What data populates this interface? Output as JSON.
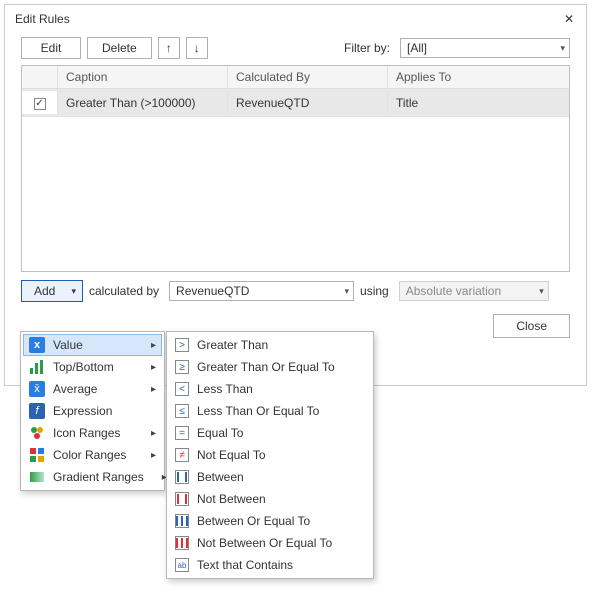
{
  "dialog": {
    "title": "Edit Rules",
    "close_icon": "✕"
  },
  "toolbar": {
    "edit": "Edit",
    "delete": "Delete",
    "up": "↑",
    "down": "↓",
    "filter_label": "Filter by:",
    "filter_value": "[All]"
  },
  "grid": {
    "headers": {
      "caption": "Caption",
      "calc": "Calculated By",
      "applies": "Applies To"
    },
    "row": {
      "checked": "✓",
      "caption": "Greater Than (>100000)",
      "calc": "RevenueQTD",
      "applies": "Title"
    }
  },
  "formula": {
    "add": "Add",
    "calc_label": "calculated by",
    "calc_value": "RevenueQTD",
    "using_label": "using",
    "using_value": "Absolute variation"
  },
  "close_label": "Close",
  "menu1": {
    "value": "Value",
    "topbottom": "Top/Bottom",
    "average": "Average",
    "expression": "Expression",
    "icon_ranges": "Icon Ranges",
    "color_ranges": "Color Ranges",
    "gradient_ranges": "Gradient Ranges"
  },
  "menu2": {
    "gt": "Greater Than",
    "gte": "Greater Than Or Equal To",
    "lt": "Less Than",
    "lte": "Less Than Or Equal To",
    "eq": "Equal To",
    "neq": "Not Equal To",
    "between": "Between",
    "not_between": "Not Between",
    "between_eq": "Between Or Equal To",
    "not_between_eq": "Not Between Or Equal To",
    "text_contains": "Text that Contains"
  },
  "glyphs": {
    "gt": ">",
    "gte": "≥",
    "lt": "<",
    "lte": "≤",
    "eq": "=",
    "neq": "≠",
    "text": "ab"
  }
}
